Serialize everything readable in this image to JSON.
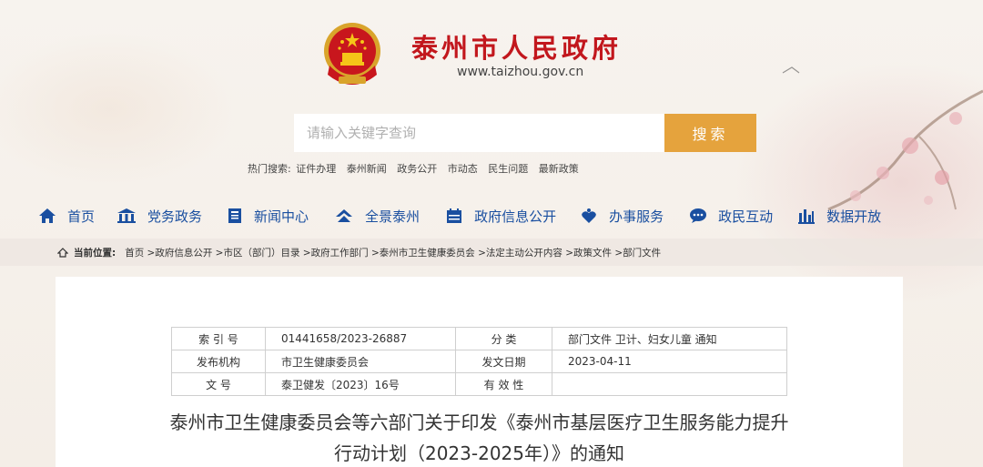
{
  "site": {
    "title": "泰州市人民政府",
    "url": "www.taizhou.gov.cn"
  },
  "search": {
    "placeholder": "请输入关键字查询",
    "button_label": "搜索"
  },
  "hot_search": {
    "label": "热门搜索:",
    "items": [
      "证件办理",
      "泰州新闻",
      "政务公开",
      "市动态",
      "民生问题",
      "最新政策"
    ]
  },
  "nav": {
    "items": [
      {
        "label": "首页",
        "icon": "home-icon"
      },
      {
        "label": "党务政务",
        "icon": "building-icon"
      },
      {
        "label": "新闻中心",
        "icon": "newspaper-icon"
      },
      {
        "label": "全景泰州",
        "icon": "panorama-icon"
      },
      {
        "label": "政府信息公开",
        "icon": "calendar-icon"
      },
      {
        "label": "办事服务",
        "icon": "handshake-icon"
      },
      {
        "label": "政民互动",
        "icon": "chat-icon"
      },
      {
        "label": "数据开放",
        "icon": "bar-chart-icon"
      }
    ]
  },
  "breadcrumb": {
    "label": "当前位置:",
    "path": "首页 >政府信息公开 >市区（部门）目录 >政府工作部门 >泰州市卫生健康委员会 >法定主动公开内容 >政策文件 >部门文件"
  },
  "meta_table": {
    "rows": [
      {
        "k1": "索 引 号",
        "v1": "01441658/2023-26887",
        "k2": "分 类",
        "v2": "部门文件 卫计、妇女儿童 通知"
      },
      {
        "k1": "发布机构",
        "v1": "市卫生健康委员会",
        "k2": "发文日期",
        "v2": "2023-04-11"
      },
      {
        "k1": "文 号",
        "v1": "泰卫健发〔2023〕16号",
        "k2": "有 效 性",
        "v2": ""
      }
    ]
  },
  "document": {
    "title_line1": "泰州市卫生健康委员会等六部门关于印发《泰州市基层医疗卫生服务能力提升",
    "title_line2": "行动计划（2023-2025年）》的通知"
  },
  "colors": {
    "brand_red": "#c2171d",
    "accent_orange": "#e5a33d",
    "nav_blue": "#1a4fa0"
  }
}
